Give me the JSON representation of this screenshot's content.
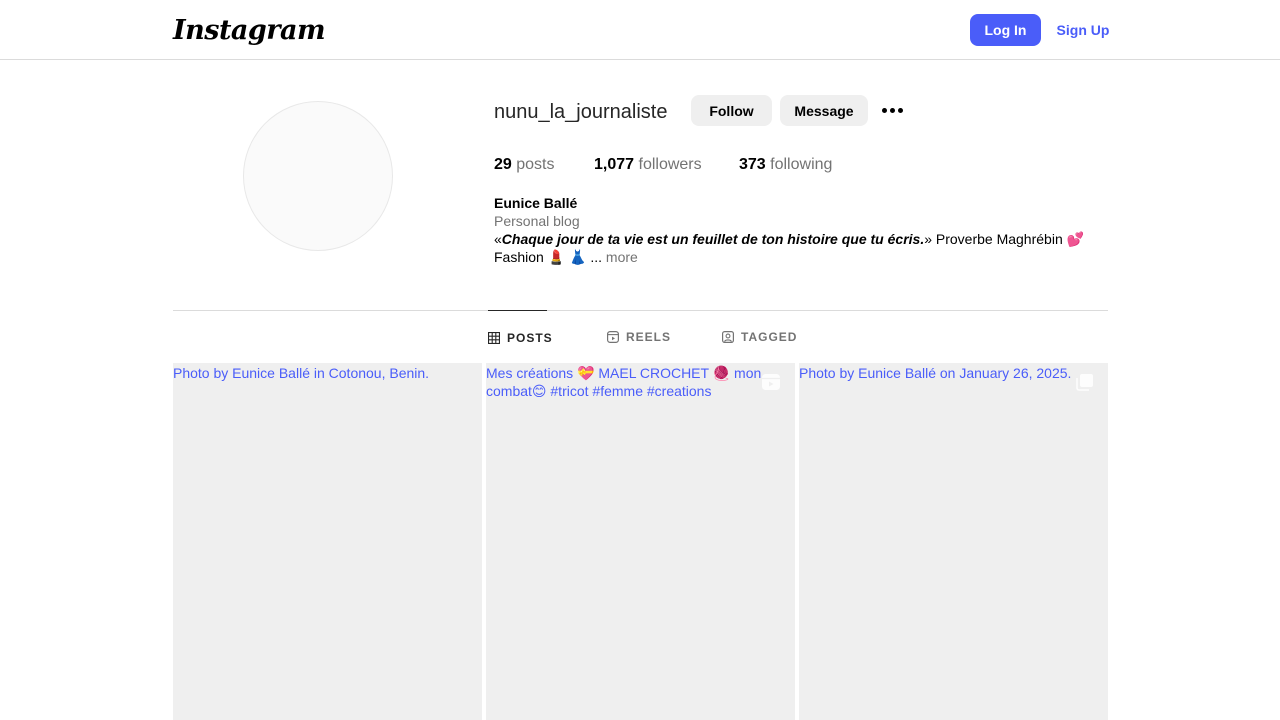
{
  "header": {
    "logo_text": "Instagram",
    "login_label": "Log In",
    "signup_label": "Sign Up"
  },
  "profile": {
    "username": "nunu_la_journaliste",
    "follow_label": "Follow",
    "message_label": "Message",
    "stats": {
      "posts_count": "29",
      "posts_label": "posts",
      "followers_count": "1,077",
      "followers_label": "followers",
      "following_count": "373",
      "following_label": "following"
    },
    "full_name": "Eunice Ballé",
    "category": "Personal blog",
    "bio_open": "«",
    "bio_quote": "Chaque jour de ta vie est un feuillet de ton histoire que tu écris.",
    "bio_close": "» Proverbe Maghrébin 💕",
    "bio_line2": "Fashion 💄 👗 ...",
    "more_label": "more"
  },
  "tabs": [
    {
      "label": "POSTS",
      "icon": "grid-icon",
      "active": true
    },
    {
      "label": "REELS",
      "icon": "reels-icon",
      "active": false
    },
    {
      "label": "TAGGED",
      "icon": "tagged-icon",
      "active": false
    }
  ],
  "posts": [
    {
      "alt": "Photo by Eunice Ballé in Cotonou, Benin.",
      "badge": "none"
    },
    {
      "alt": "Mes créations 💝 MAEL CROCHET 🧶 mon combat😊 #tricot #femme #creations",
      "badge": "reel-icon"
    },
    {
      "alt": "Photo by Eunice Ballé on January 26, 2025.",
      "badge": "carousel-icon"
    }
  ],
  "colors": {
    "accent": "#4a5df9",
    "tile_bg": "#efefef",
    "secondary_text": "#737373"
  }
}
